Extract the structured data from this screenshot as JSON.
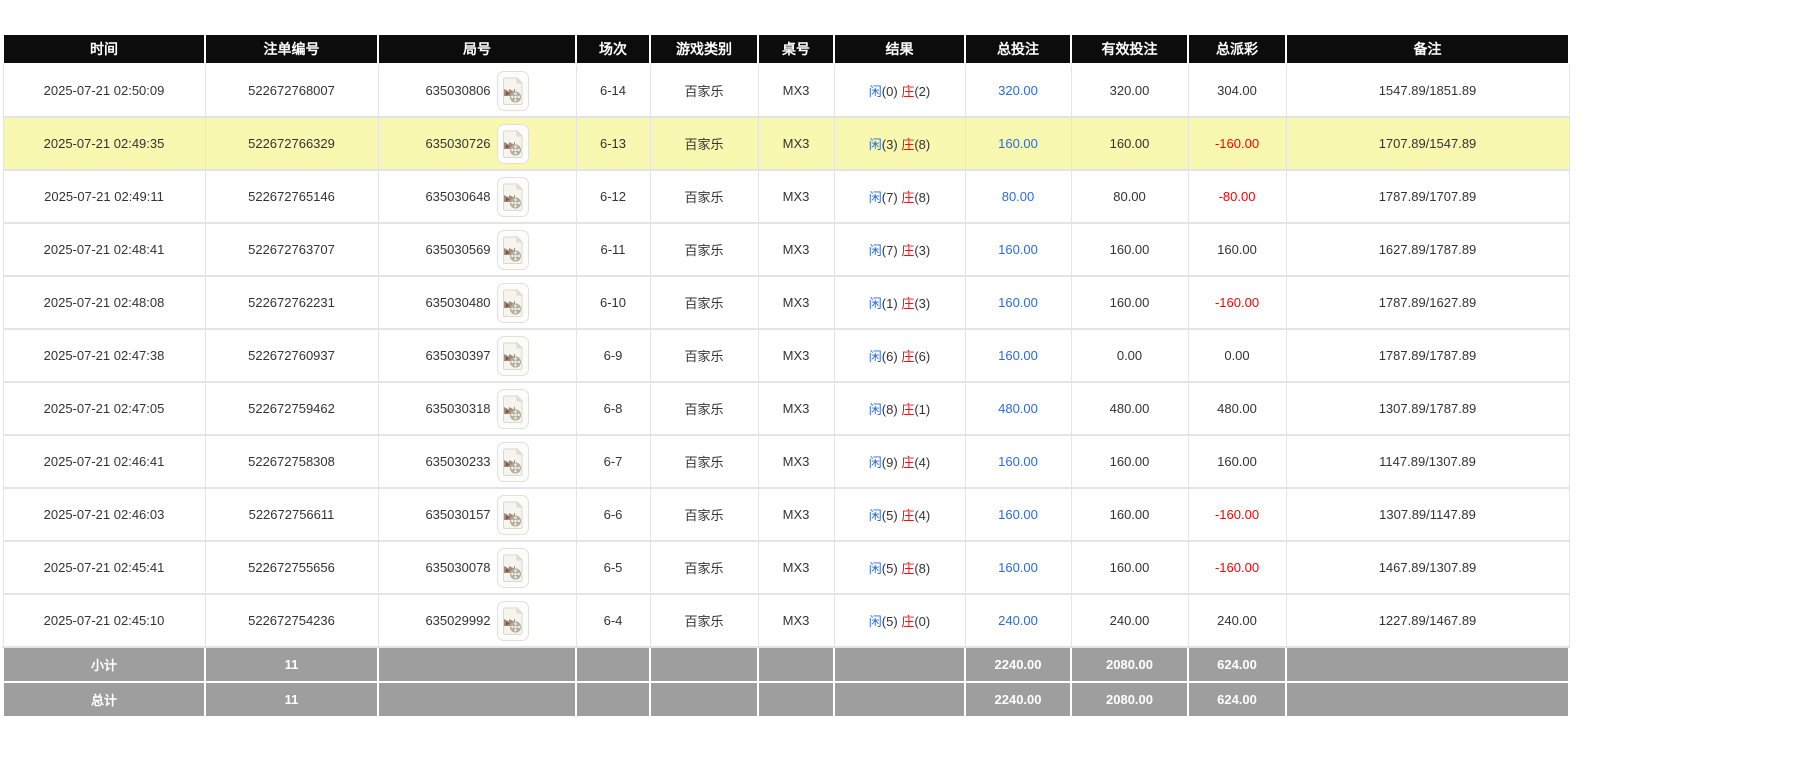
{
  "table": {
    "columns": [
      "时间",
      "注单编号",
      "局号",
      "场次",
      "游戏类别",
      "桌号",
      "结果",
      "总投注",
      "有效投注",
      "总派彩",
      "备注"
    ],
    "icons": {
      "video_replay": "video-clip-icon"
    },
    "rows": [
      {
        "time": "2025-07-21 02:50:09",
        "bet_id": "522672768007",
        "round_id": "635030806",
        "session": "6-14",
        "game": "百家乐",
        "table_no": "MX3",
        "player_label": "闲",
        "player_score": "(0)",
        "banker_label": "庄",
        "banker_score": "(2)",
        "total_bet": "320.00",
        "valid_bet": "320.00",
        "payout": "304.00",
        "remark": "1547.89/1851.89",
        "highlighted": false
      },
      {
        "time": "2025-07-21 02:49:35",
        "bet_id": "522672766329",
        "round_id": "635030726",
        "session": "6-13",
        "game": "百家乐",
        "table_no": "MX3",
        "player_label": "闲",
        "player_score": "(3)",
        "banker_label": "庄",
        "banker_score": "(8)",
        "total_bet": "160.00",
        "valid_bet": "160.00",
        "payout": "-160.00",
        "remark": "1707.89/1547.89",
        "highlighted": true
      },
      {
        "time": "2025-07-21 02:49:11",
        "bet_id": "522672765146",
        "round_id": "635030648",
        "session": "6-12",
        "game": "百家乐",
        "table_no": "MX3",
        "player_label": "闲",
        "player_score": "(7)",
        "banker_label": "庄",
        "banker_score": "(8)",
        "total_bet": "80.00",
        "valid_bet": "80.00",
        "payout": "-80.00",
        "remark": "1787.89/1707.89",
        "highlighted": false
      },
      {
        "time": "2025-07-21 02:48:41",
        "bet_id": "522672763707",
        "round_id": "635030569",
        "session": "6-11",
        "game": "百家乐",
        "table_no": "MX3",
        "player_label": "闲",
        "player_score": "(7)",
        "banker_label": "庄",
        "banker_score": "(3)",
        "total_bet": "160.00",
        "valid_bet": "160.00",
        "payout": "160.00",
        "remark": "1627.89/1787.89",
        "highlighted": false
      },
      {
        "time": "2025-07-21 02:48:08",
        "bet_id": "522672762231",
        "round_id": "635030480",
        "session": "6-10",
        "game": "百家乐",
        "table_no": "MX3",
        "player_label": "闲",
        "player_score": "(1)",
        "banker_label": "庄",
        "banker_score": "(3)",
        "total_bet": "160.00",
        "valid_bet": "160.00",
        "payout": "-160.00",
        "remark": "1787.89/1627.89",
        "highlighted": false
      },
      {
        "time": "2025-07-21 02:47:38",
        "bet_id": "522672760937",
        "round_id": "635030397",
        "session": "6-9",
        "game": "百家乐",
        "table_no": "MX3",
        "player_label": "闲",
        "player_score": "(6)",
        "banker_label": "庄",
        "banker_score": "(6)",
        "total_bet": "160.00",
        "valid_bet": "0.00",
        "payout": "0.00",
        "remark": "1787.89/1787.89",
        "highlighted": false
      },
      {
        "time": "2025-07-21 02:47:05",
        "bet_id": "522672759462",
        "round_id": "635030318",
        "session": "6-8",
        "game": "百家乐",
        "table_no": "MX3",
        "player_label": "闲",
        "player_score": "(8)",
        "banker_label": "庄",
        "banker_score": "(1)",
        "total_bet": "480.00",
        "valid_bet": "480.00",
        "payout": "480.00",
        "remark": "1307.89/1787.89",
        "highlighted": false
      },
      {
        "time": "2025-07-21 02:46:41",
        "bet_id": "522672758308",
        "round_id": "635030233",
        "session": "6-7",
        "game": "百家乐",
        "table_no": "MX3",
        "player_label": "闲",
        "player_score": "(9)",
        "banker_label": "庄",
        "banker_score": "(4)",
        "total_bet": "160.00",
        "valid_bet": "160.00",
        "payout": "160.00",
        "remark": "1147.89/1307.89",
        "highlighted": false
      },
      {
        "time": "2025-07-21 02:46:03",
        "bet_id": "522672756611",
        "round_id": "635030157",
        "session": "6-6",
        "game": "百家乐",
        "table_no": "MX3",
        "player_label": "闲",
        "player_score": "(5)",
        "banker_label": "庄",
        "banker_score": "(4)",
        "total_bet": "160.00",
        "valid_bet": "160.00",
        "payout": "-160.00",
        "remark": "1307.89/1147.89",
        "highlighted": false
      },
      {
        "time": "2025-07-21 02:45:41",
        "bet_id": "522672755656",
        "round_id": "635030078",
        "session": "6-5",
        "game": "百家乐",
        "table_no": "MX3",
        "player_label": "闲",
        "player_score": "(5)",
        "banker_label": "庄",
        "banker_score": "(8)",
        "total_bet": "160.00",
        "valid_bet": "160.00",
        "payout": "-160.00",
        "remark": "1467.89/1307.89",
        "highlighted": false
      },
      {
        "time": "2025-07-21 02:45:10",
        "bet_id": "522672754236",
        "round_id": "635029992",
        "session": "6-4",
        "game": "百家乐",
        "table_no": "MX3",
        "player_label": "闲",
        "player_score": "(5)",
        "banker_label": "庄",
        "banker_score": "(0)",
        "total_bet": "240.00",
        "valid_bet": "240.00",
        "payout": "240.00",
        "remark": "1227.89/1467.89",
        "highlighted": false
      }
    ],
    "subtotal": {
      "label": "小计",
      "count": "11",
      "total_bet": "2240.00",
      "valid_bet": "2080.00",
      "payout": "624.00"
    },
    "total": {
      "label": "总计",
      "count": "11",
      "total_bet": "2240.00",
      "valid_bet": "2080.00",
      "payout": "624.00"
    }
  },
  "colors": {
    "header_bg": "#0c0c0c",
    "highlight_row": "#f8f8b0",
    "summary_bg": "#9e9e9e",
    "link_blue": "#2a6be0",
    "negative_red": "#ff0000",
    "banker_red": "#ee1111"
  }
}
